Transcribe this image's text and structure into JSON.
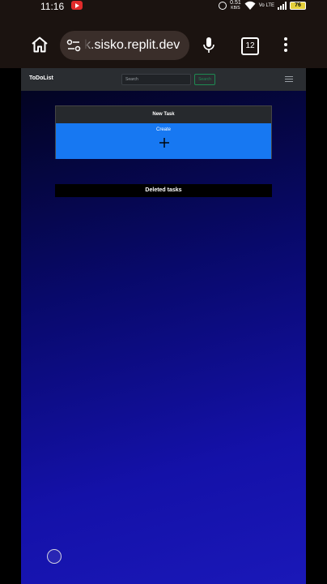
{
  "status_bar": {
    "time": "11:16",
    "net_speed": "0.51",
    "net_unit": "KB/S",
    "volte": "Vo LTE",
    "battery": "76"
  },
  "browser": {
    "url": "k.sisko.replit.dev",
    "tab_count": "12"
  },
  "app": {
    "brand": "ToDoList",
    "search": {
      "placeholder": "Search",
      "button_label": "Search"
    },
    "new_task": {
      "header": "New Task",
      "create_label": "Create"
    },
    "deleted_tasks_label": "Deleted tasks"
  },
  "colors": {
    "create_bg": "#1778f2",
    "search_button": "#1e8a52",
    "navbar_bg": "#2a2d31",
    "battery": "#e4cf3a"
  }
}
